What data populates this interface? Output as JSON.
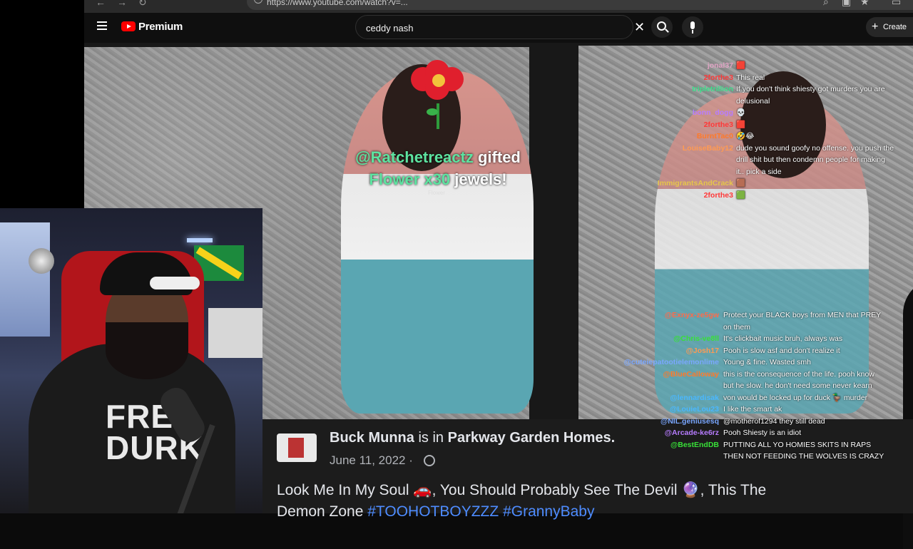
{
  "browser": {
    "url": "https://www.youtube.com/watch?v=..."
  },
  "header": {
    "brand": "Premium",
    "search_value": "ceddy nash",
    "create_label": "Create"
  },
  "gift": {
    "user": "@Ratchetreactz",
    "word_gifted": "gifted",
    "item": "Flower",
    "count": "x30",
    "suffix": "jewels!",
    "label": "Flower"
  },
  "post": {
    "author": "Buck Munna",
    "is_in": "is in",
    "place": "Parkway Garden Homes.",
    "date": "June 11, 2022 ·",
    "text_line1": "Look Me In My Soul 🚗, You Should Probably See The Devil 🔮, This The",
    "text_line2_prefix": "Demon Zone",
    "tag1": "#TOOHOTBOYZZZ",
    "tag2": "#GrannyBaby"
  },
  "chat_top": [
    {
      "user": "jonal37",
      "color": "#e0a3c4",
      "msg": "🟥"
    },
    {
      "user": "2forthe3",
      "color": "#ff3838",
      "msg": "This real"
    },
    {
      "user": "tripletrillion",
      "color": "#38e08a",
      "msg": "If you don't think shiesty got murders you are"
    },
    {
      "user": "",
      "color": "#ffffff",
      "msg": "delusional"
    },
    {
      "user": "bonn_dogg",
      "color": "#b77cff",
      "msg": "💀"
    },
    {
      "user": "2forthe3",
      "color": "#ff3838",
      "msg": "🟥"
    },
    {
      "user": "BurntTac0",
      "color": "#ff7a2a",
      "msg": "🤣😂"
    },
    {
      "user": "LouiseBaby12",
      "color": "#ff9a52",
      "msg": "dude you sound goofy no offense. you push the"
    },
    {
      "user": "",
      "color": "#ffffff",
      "msg": "drill shit but then condemn people for making"
    },
    {
      "user": "",
      "color": "#ffffff",
      "msg": "it.. pick a side"
    },
    {
      "user": "ImmigrantsAndCrack",
      "color": "#e6c64a",
      "msg": "🟫"
    },
    {
      "user": "2forthe3",
      "color": "#ff3838",
      "msg": "🟩"
    }
  ],
  "chat_bottom": [
    {
      "user": "@Exnyx-ze5gw",
      "color": "#ff6a4a",
      "msg": "Protect your BLACK boys from MEN that PREY"
    },
    {
      "user": "",
      "color": "#ffffff",
      "msg": "on them"
    },
    {
      "user": "@Chris-ve8ll",
      "color": "#38e038",
      "msg": "It's clickbait music bruh, always was"
    },
    {
      "user": "@Josh17",
      "color": "#ff9a52",
      "msg": "Pooh is slow asf and don't realize it"
    },
    {
      "user": "@cuteiepatootielemonlime",
      "color": "#7aa7ff",
      "msg": "Young & fine. Wasted smh"
    },
    {
      "user": "@BlueCalloway",
      "color": "#ff7a2a",
      "msg": "this is the consequence of the life. pooh know"
    },
    {
      "user": "",
      "color": "#ffffff",
      "msg": "but he slow. he don't need some never kearn"
    },
    {
      "user": "@lennardisak",
      "color": "#4ab7ff",
      "msg": "von would be locked up for duck 🦆 murder"
    },
    {
      "user": "@LouieLou23",
      "color": "#4ab7ff",
      "msg": "I like the smart ak"
    },
    {
      "user": "@NIL.geniusesq",
      "color": "#7aa7ff",
      "msg": "@motherof1294 they still dead"
    },
    {
      "user": "@Arcade-ke6rz",
      "color": "#b77cff",
      "msg": "Pooh Shiesty is an idiot"
    },
    {
      "user": "@BestEndDB",
      "color": "#38e038",
      "msg": "PUTTING ALL YO HOMIES SKITS IN RAPS"
    },
    {
      "user": "",
      "color": "#ffffff",
      "msg": "THEN NOT FEEDING THE WOLVES IS CRAZY"
    }
  ],
  "webcam": {
    "shirt_line1": "FREE",
    "shirt_line2": "DURK"
  }
}
